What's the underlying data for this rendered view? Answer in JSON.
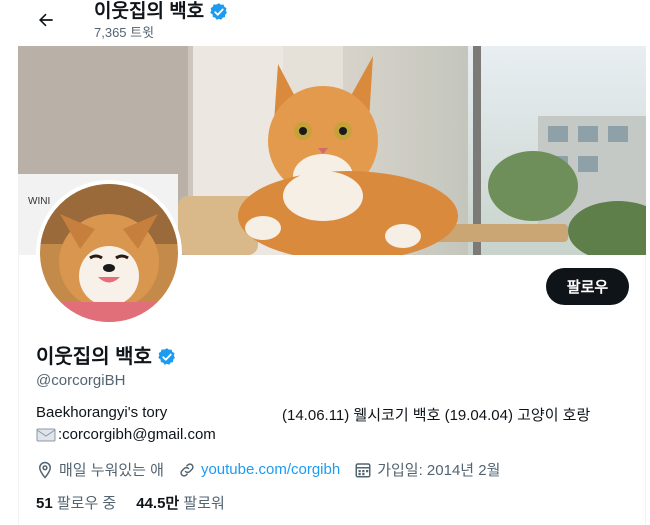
{
  "header": {
    "display_name": "이웃집의 백호",
    "tweet_count": "7,365 트윗"
  },
  "profile": {
    "display_name": "이웃집의 백호",
    "handle": "@corcorgiBH",
    "follow_label": "팔로우",
    "bio_line1_left": "Baekhorangyi's tory",
    "bio_line1_right": "(14.06.11) 웰시코기 백호 (19.04.04) 고양이 호랑",
    "bio_email": ":corcorgibh@gmail.com",
    "location": "매일 누워있는 애",
    "website": "youtube.com/corgibh",
    "joined": "가입일: 2014년 2월",
    "following_count": "51",
    "following_label": "팔로우 중",
    "followers_count": "44.5만",
    "followers_label": "팔로워"
  },
  "colors": {
    "accent": "#1d9bf0",
    "text_primary": "#0f1419",
    "text_secondary": "#536471",
    "verified": "#1d9bf0"
  },
  "icons": [
    "back-arrow-icon",
    "verified-badge-icon",
    "envelope-icon",
    "location-pin-icon",
    "link-icon",
    "calendar-icon"
  ]
}
